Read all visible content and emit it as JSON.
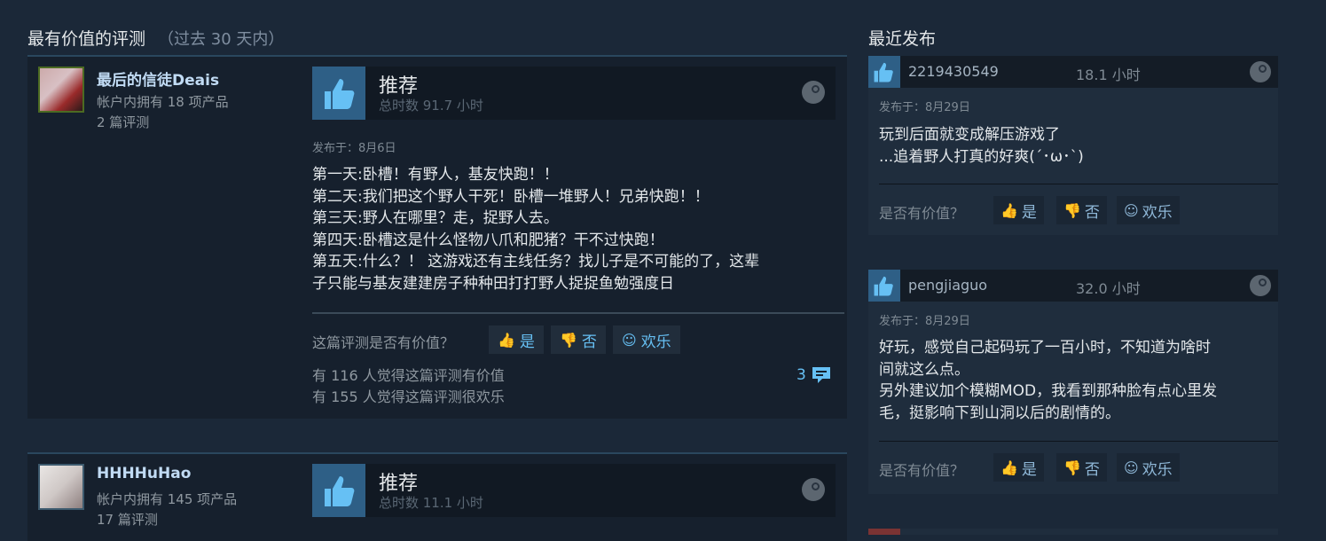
{
  "left_header": {
    "title": "最有价值的评测",
    "subtitle": "（过去 30 天内）"
  },
  "right_header": {
    "title": "最近发布"
  },
  "reviews": [
    {
      "author": "最后的信徒Deais",
      "products": "帐户内拥有 18 项产品",
      "review_count": "2 篇评测",
      "verdict": "推荐",
      "hours": "总时数 91.7 小时",
      "posted": "发布于：8月6日",
      "text": "第一天:卧槽！有野人，基友快跑！！\n第二天:我们把这个野人干死！卧槽一堆野人！兄弟快跑！！\n第三天:野人在哪里？走，捉野人去。\n第四天:卧槽这是什么怪物八爪和肥猪？干不过快跑！\n第五天:什么？！ 这游戏还有主线任务？找儿子是不可能的了，这辈\n子只能与基友建建房子种种田打打野人捉捉鱼勉强度日",
      "helpful_question": "这篇评测是否有价值？",
      "btn_yes": "是",
      "btn_no": "否",
      "btn_funny": "欢乐",
      "helpful_stat": "有 116 人觉得这篇评测有价值",
      "funny_stat": "有 155 人觉得这篇评测很欢乐",
      "comments": "3"
    },
    {
      "author": "HHHHuHao",
      "products": "帐户内拥有 145 项产品",
      "review_count": "17 篇评测",
      "verdict": "推荐",
      "hours": "总时数 11.1 小时"
    }
  ],
  "recent": [
    {
      "user": "2219430549",
      "hours": "18.1 小时",
      "posted": "发布于：8月29日",
      "text": "玩到后面就变成解压游戏了\n...追着野人打真的好爽(´･ω･`)",
      "question": "是否有价值？",
      "btn_yes": "是",
      "btn_no": "否",
      "btn_funny": "欢乐"
    },
    {
      "user": "pengjiaguo",
      "hours": "32.0 小时",
      "posted": "发布于：8月29日",
      "text": "好玩，感觉自己起码玩了一百小时，不知道为啥时\n间就这么点。\n另外建议加个模糊MOD，我看到那种脸有点心里发\n毛，挺影响下到山洞以后的剧情的。",
      "question": "是否有价值？",
      "btn_yes": "是",
      "btn_no": "否",
      "btn_funny": "欢乐"
    }
  ],
  "colors": {
    "accent": "#66c0f4",
    "background": "#1b2838",
    "thumb_bg": "#2e5f86"
  }
}
